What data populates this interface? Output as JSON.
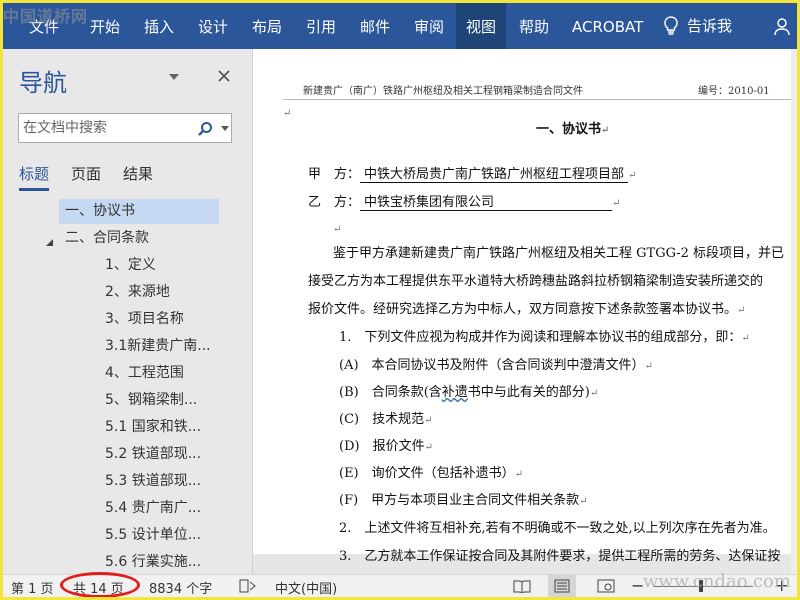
{
  "watermark": {
    "top_left": "中国道桥网",
    "bottom_right": "www.cndao.com"
  },
  "ribbon": {
    "tabs": [
      "文件",
      "开始",
      "插入",
      "设计",
      "布局",
      "引用",
      "邮件",
      "审阅",
      "视图",
      "帮助",
      "ACROBAT"
    ],
    "active_tab": "视图",
    "tell_me": "告诉我"
  },
  "nav": {
    "title": "导航",
    "search_placeholder": "在文档中搜索",
    "tabs": [
      "标题",
      "页面",
      "结果"
    ],
    "active_tab": "标题",
    "items": [
      {
        "label": "一、协议书",
        "level": 1,
        "selected": true
      },
      {
        "label": "二、合同条款",
        "level": 1,
        "expanded": true
      },
      {
        "label": "1、定义",
        "level": 2
      },
      {
        "label": "2、来源地",
        "level": 2
      },
      {
        "label": "3、项目名称",
        "level": 2
      },
      {
        "label": "3.1新建贵广南...",
        "level": 2
      },
      {
        "label": "4、工程范围",
        "level": 2
      },
      {
        "label": "5、钢箱梁制...",
        "level": 2
      },
      {
        "label": "5.1 国家和铁...",
        "level": 2
      },
      {
        "label": "5.2 铁道部现...",
        "level": 2
      },
      {
        "label": "5.3 铁道部现...",
        "level": 2
      },
      {
        "label": "5.4 贵广南广...",
        "level": 2
      },
      {
        "label": "5.5 设计单位...",
        "level": 2
      },
      {
        "label": "5.6 行業实施...",
        "level": 2
      }
    ]
  },
  "document": {
    "header_title": "新建贵广（南广）铁路广州枢纽及相关工程钢箱梁制造合同文件",
    "header_number": "编号：2010-01",
    "heading": "一、协议书",
    "party_a_label": "甲　方：",
    "party_a": "中铁大桥局贵广南广铁路广州枢纽工程项目部",
    "party_b_label": "乙　方：",
    "party_b": "中铁宝桥集团有限公司",
    "para1": "鉴于甲方承建新建贵广南广铁路广州枢纽及相关工程 GTGG-2 标段项目，并已",
    "para2": "接受乙方为本工程提供东平水道特大桥跨穗盐路斜拉桥钢箱梁制造安装所递交的",
    "para3": "报价文件。经研究选择乙方为中标人，双方同意按下述条款签署本协议书。",
    "item1": "1.　下列文件应视为构成并作为阅读和理解本协议书的组成部分，即：",
    "itemA": "(A)　本合同协议书及附件（含合同谈判中澄清文件）",
    "itemB_pre": "(B)　合同条款(含",
    "itemB_wavy": "补遗",
    "itemB_post": "书中与此有关的部分)",
    "itemC": "(C)　技术规范",
    "itemD": "(D)　报价文件",
    "itemE": "(E)　询价文件（包括补遗书）",
    "itemF": "(F)　甲方与本项目业主合同文件相关条款",
    "item2": "2.　上述文件将互相补充,若有不明确或不一致之处,以上列次序在先者为准。",
    "item3": "3.　乙方就本工作保证按合同及其附件要求，提供工程所需的劳务、达保证按"
  },
  "status": {
    "page": "第 1 页",
    "total_pages": "共 14 页",
    "words": "8834 个字",
    "language": "中文(中国)",
    "zoom_minus": "−",
    "zoom_plus": "+"
  },
  "colors": {
    "accent": "#2b579a",
    "frame": "#f3e53c",
    "highlight_oval": "#e21b1b"
  }
}
